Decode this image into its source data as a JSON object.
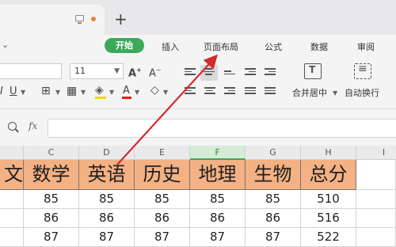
{
  "tabbar": {
    "new_tab_label": "+"
  },
  "menu": {
    "start": "开始",
    "insert": "插入",
    "page_layout": "页面布局",
    "formulas": "公式",
    "data": "数据",
    "review": "审阅"
  },
  "ribbon": {
    "font_size": "11",
    "merge_center": "合并居中",
    "wrap_text": "自动换行"
  },
  "formula_bar": {
    "fx": "fx",
    "value": ""
  },
  "columns": [
    "C",
    "D",
    "E",
    "F",
    "G",
    "H",
    "I"
  ],
  "active_column": "F",
  "table": {
    "headers": [
      "文",
      "数学",
      "英语",
      "历史",
      "地理",
      "生物",
      "总分"
    ],
    "rows": [
      [
        "",
        "85",
        "85",
        "85",
        "85",
        "85",
        "510"
      ],
      [
        "",
        "86",
        "86",
        "86",
        "86",
        "86",
        "516"
      ],
      [
        "",
        "87",
        "87",
        "87",
        "87",
        "87",
        "522"
      ]
    ]
  },
  "colors": {
    "accent": "#3aa95a",
    "header_fill": "#f4b183",
    "arrow": "#d42a2a"
  }
}
